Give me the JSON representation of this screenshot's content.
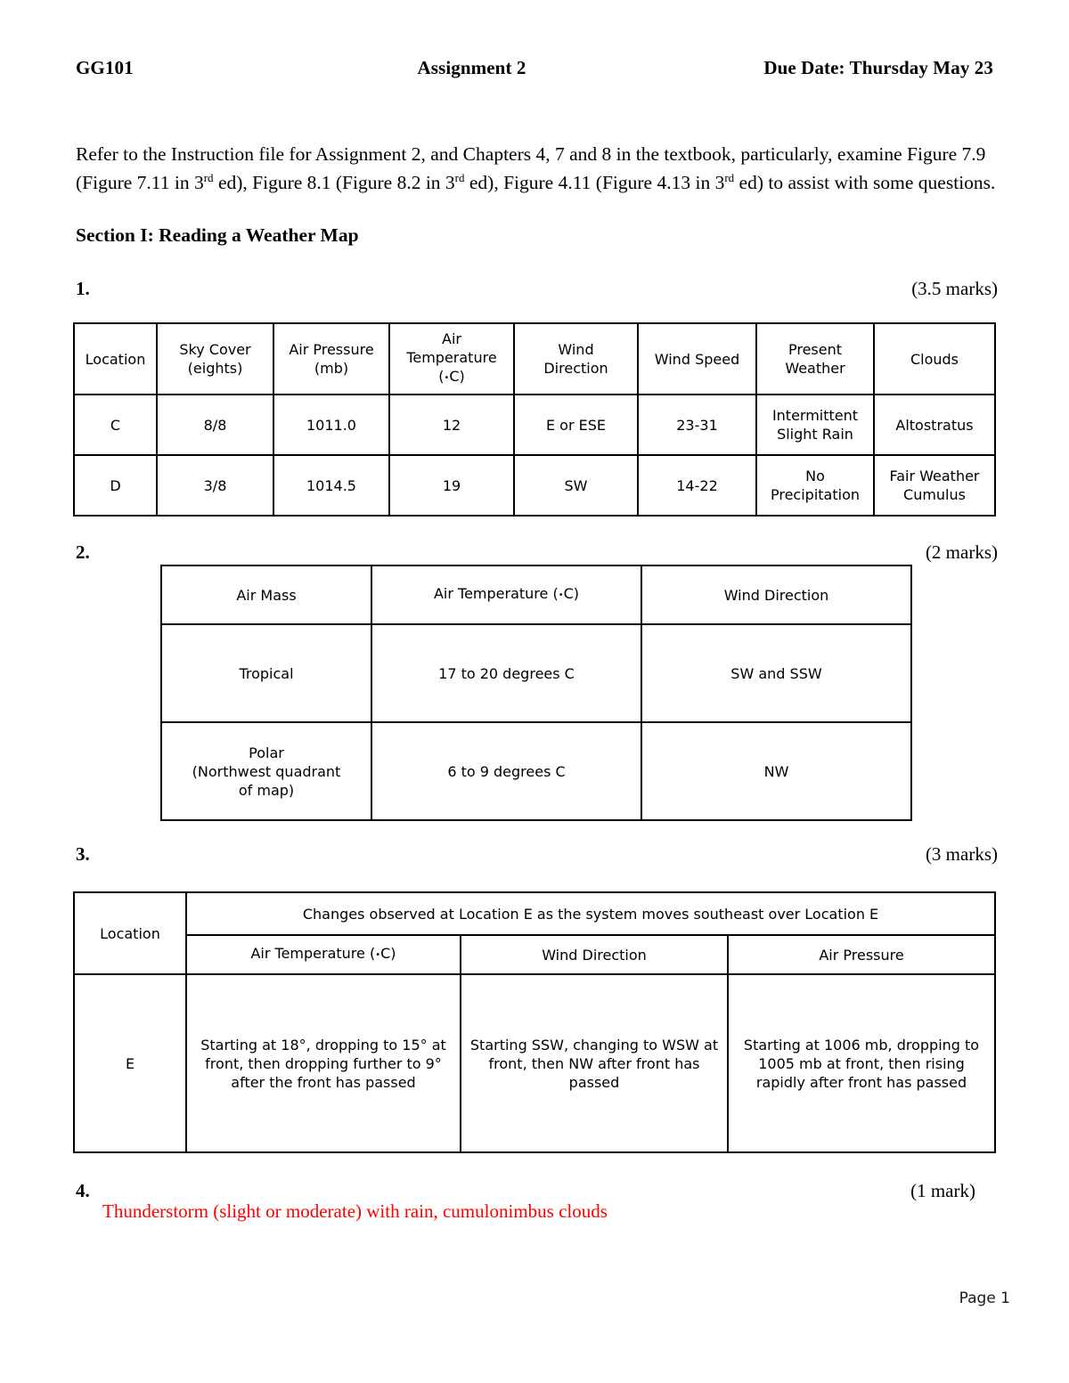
{
  "header": {
    "course_code": "GG101",
    "title": "Assignment 2",
    "due_date": "Due Date: Thursday May 23"
  },
  "intro": {
    "line1": "Refer to the Instruction file for Assignment 2, and Chapters 4, 7 and 8 in the textbook, particularly, examine",
    "line2_a": "Figure 7.9 (Figure 7.11 in 3",
    "sup1": "rd",
    "line2_b": " ed), Figure 8.1 (Figure 8.2 in 3",
    "sup2": "rd",
    "line2_c": " ed), Figure 4.11 (Figure 4.13 in 3",
    "sup3": "rd",
    "line2_d": " ed) to assist",
    "line3": "with some questions."
  },
  "section": {
    "heading": "Section I: Reading a Weather Map"
  },
  "questions": [
    {
      "number": "1.",
      "marks": "(3.5 marks)"
    },
    {
      "number": "2.",
      "marks": "(2 marks)"
    },
    {
      "number": "3.",
      "marks": "(3 marks)"
    },
    {
      "number": "4.",
      "marks": "(1 mark)"
    }
  ],
  "table1": {
    "headers": {
      "location": "Location",
      "sky_cover": "Sky Cover",
      "sky_cover_unit": "(eights)",
      "air_pressure": "Air Pressure",
      "air_pressure_unit": "(mb)",
      "air_temperature_l1": "Air",
      "air_temperature_l2": "Temperature",
      "air_temperature_unit": "C)",
      "wind_direction_l1": "Wind",
      "wind_direction_l2": "Direction",
      "wind_speed": "Wind Speed",
      "present_weather_l1": "Present",
      "present_weather_l2": "Weather",
      "clouds": "Clouds"
    },
    "rows": [
      {
        "location": "C",
        "sky_cover": "8/8",
        "air_pressure": "1011.0",
        "air_temperature": "12",
        "wind_direction": "E or ESE",
        "wind_speed": "23-31",
        "present_weather": "Intermittent Slight Rain",
        "clouds": "Altostratus"
      },
      {
        "location": "D",
        "sky_cover": "3/8",
        "air_pressure": "1014.5",
        "air_temperature": "19",
        "wind_direction": "SW",
        "wind_speed": "14-22",
        "present_weather": "No Precipitation",
        "clouds": "Fair Weather Cumulus"
      }
    ]
  },
  "table2": {
    "headers": {
      "air_mass": "Air Mass",
      "air_temperature": "Air Temperature (",
      "air_temperature_tail": "C)",
      "wind_direction": "Wind Direction"
    },
    "rows": [
      {
        "air_mass": "Tropical",
        "air_temperature": "17 to 20 degrees C",
        "wind_direction": "SW and SSW"
      },
      {
        "air_mass_l1": "Polar",
        "air_mass_l2": "(Northwest quadrant",
        "air_mass_l3": "of map)",
        "air_temperature": "6 to 9 degrees C",
        "wind_direction": "NW"
      }
    ]
  },
  "table3": {
    "headers": {
      "location": "Location",
      "span_title": "Changes observed at Location E as the system moves southeast over Location E",
      "air_temperature": "Air Temperature (",
      "air_temperature_tail": "C)",
      "wind_direction": "Wind Direction",
      "air_pressure": "Air Pressure"
    },
    "rows": [
      {
        "location": "E",
        "air_temperature": "Starting at 18°, dropping to 15° at front, then dropping further to 9° after the front has passed",
        "wind_direction": "Starting SSW, changing to WSW at front, then NW after front has passed",
        "air_pressure": "Starting at 1006 mb, dropping to 1005 mb at front, then rising rapidly after front has passed"
      }
    ]
  },
  "question4": {
    "answer": "Thunderstorm (slight or moderate) with rain, cumulonimbus clouds"
  },
  "footer": {
    "page_label": "Page 1"
  },
  "colors": {
    "answer_red": "#FF0000",
    "text_black": "#000000",
    "background": "#FFFFFF"
  }
}
